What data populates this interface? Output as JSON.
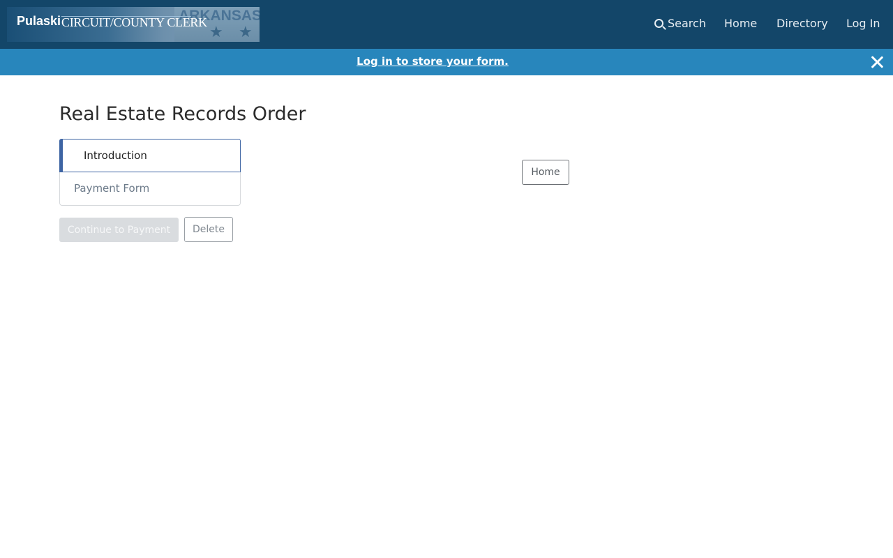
{
  "header": {
    "logo": {
      "brand": "Pulaski",
      "subtitle": "CIRCUIT/COUNTY CLERK",
      "flag_text": "ARKANSAS"
    },
    "nav": {
      "search_label": "Search",
      "home_label": "Home",
      "directory_label": "Directory",
      "login_label": "Log In"
    }
  },
  "banner": {
    "message": "Log in to store your form."
  },
  "main": {
    "title": "Real Estate Records Order",
    "steps": [
      {
        "label": "Introduction",
        "active": true
      },
      {
        "label": "Payment Form",
        "active": false
      }
    ],
    "buttons": {
      "continue_label": "Continue to Payment",
      "delete_label": "Delete",
      "home_label": "Home"
    }
  },
  "colors": {
    "navbar": "#134669",
    "banner": "#2886bc",
    "accent": "#3d64a3"
  },
  "icons": [
    "search-icon",
    "close-icon"
  ]
}
